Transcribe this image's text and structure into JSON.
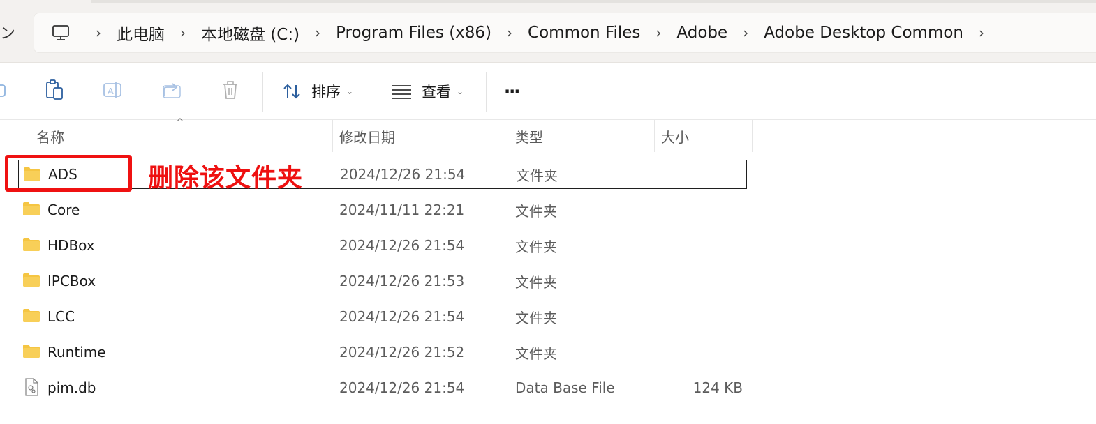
{
  "edge_glyph": "ン",
  "breadcrumb": {
    "items": [
      "此电脑",
      "本地磁盘 (C:)",
      "Program Files (x86)",
      "Common Files",
      "Adobe",
      "Adobe Desktop Common"
    ],
    "separator": "›"
  },
  "toolbar": {
    "icons": [
      "cut-icon",
      "paste-icon",
      "rename-icon",
      "share-icon",
      "delete-icon"
    ],
    "sort_label": "排序",
    "view_label": "查看",
    "more_label": "···"
  },
  "columns": {
    "name": "名称",
    "date": "修改日期",
    "type": "类型",
    "size": "大小"
  },
  "rows": [
    {
      "icon": "folder-icon",
      "name": "ADS",
      "date": "2024/12/26 21:54",
      "type": "文件夹",
      "size": ""
    },
    {
      "icon": "folder-icon",
      "name": "Core",
      "date": "2024/11/11 22:21",
      "type": "文件夹",
      "size": ""
    },
    {
      "icon": "folder-icon",
      "name": "HDBox",
      "date": "2024/12/26 21:54",
      "type": "文件夹",
      "size": ""
    },
    {
      "icon": "folder-icon",
      "name": "IPCBox",
      "date": "2024/12/26 21:53",
      "type": "文件夹",
      "size": ""
    },
    {
      "icon": "folder-icon",
      "name": "LCC",
      "date": "2024/12/26 21:54",
      "type": "文件夹",
      "size": ""
    },
    {
      "icon": "folder-icon",
      "name": "Runtime",
      "date": "2024/12/26 21:52",
      "type": "文件夹",
      "size": ""
    },
    {
      "icon": "file-icon",
      "name": "pim.db",
      "date": "2024/12/26 21:54",
      "type": "Data Base File",
      "size": "124 KB"
    }
  ],
  "annotation": {
    "text": "删除该文件夹",
    "color": "#ee1010"
  },
  "colors": {
    "folder": "#f5c542",
    "selection_border": "#1f1f1f"
  }
}
